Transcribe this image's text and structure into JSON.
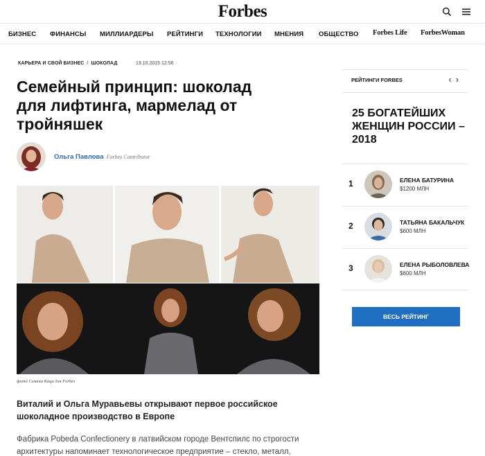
{
  "header": {
    "logo": "Forbes",
    "icons": [
      "search-icon",
      "menu-icon"
    ]
  },
  "nav": {
    "items": [
      {
        "label": "БИЗНЕС"
      },
      {
        "label": "ФИНАНСЫ"
      },
      {
        "label": "МИЛЛИАРДЕРЫ"
      },
      {
        "label": "РЕЙТИНГИ"
      },
      {
        "label": "ТЕХНОЛОГИИ"
      },
      {
        "label": "МНЕНИЯ"
      },
      {
        "label": "ОБЩЕСТВО"
      },
      {
        "label": "Forbes Life"
      },
      {
        "label": "ForbesWoman"
      }
    ]
  },
  "article": {
    "breadcrumbs": [
      "КАРЬЕРА И СВОЙ БИЗНЕС",
      "ШОКОЛАД"
    ],
    "breadcrumb_sep": "/",
    "date": "13.10.2015 12:56",
    "title": "Семейный принцип: шоколад для лифтинга, мармелад от тройняшек",
    "author_name": "Ольга Павлова",
    "author_role": "Forbes Contributor",
    "photo_caption": "фото Семена Каца для Forbes",
    "lead": "Виталий и Ольга Муравьевы открывают первое российское шоколадное производство в Европе",
    "body": "Фабрика Pobeda Confectionery в латвийском городе Вентспилс по строгости архитектуры напоминает технологическое предприятие – стекло, металл,"
  },
  "sidebar": {
    "header_label": "РЕЙТИНГИ FORBES",
    "prev_arrow": "‹",
    "next_arrow": "›",
    "title": "25 БОГАТЕЙШИХ ЖЕНЩИН РОССИИ – 2018",
    "ranking": [
      {
        "rank": "1",
        "name": "ЕЛЕНА БАТУРИНА",
        "money": "$1200 МЛН"
      },
      {
        "rank": "2",
        "name": "ТАТЬЯНА БАКАЛЬЧУК",
        "money": "$600 МЛН"
      },
      {
        "rank": "3",
        "name": "ЕЛЕНА РЫБОЛОВЛЕВА",
        "money": "$600 МЛН"
      }
    ],
    "button_label": "ВЕСЬ РЕЙТИНГ"
  },
  "colors": {
    "accent": "#1f6ec0",
    "author_link": "#2b6cb0"
  }
}
